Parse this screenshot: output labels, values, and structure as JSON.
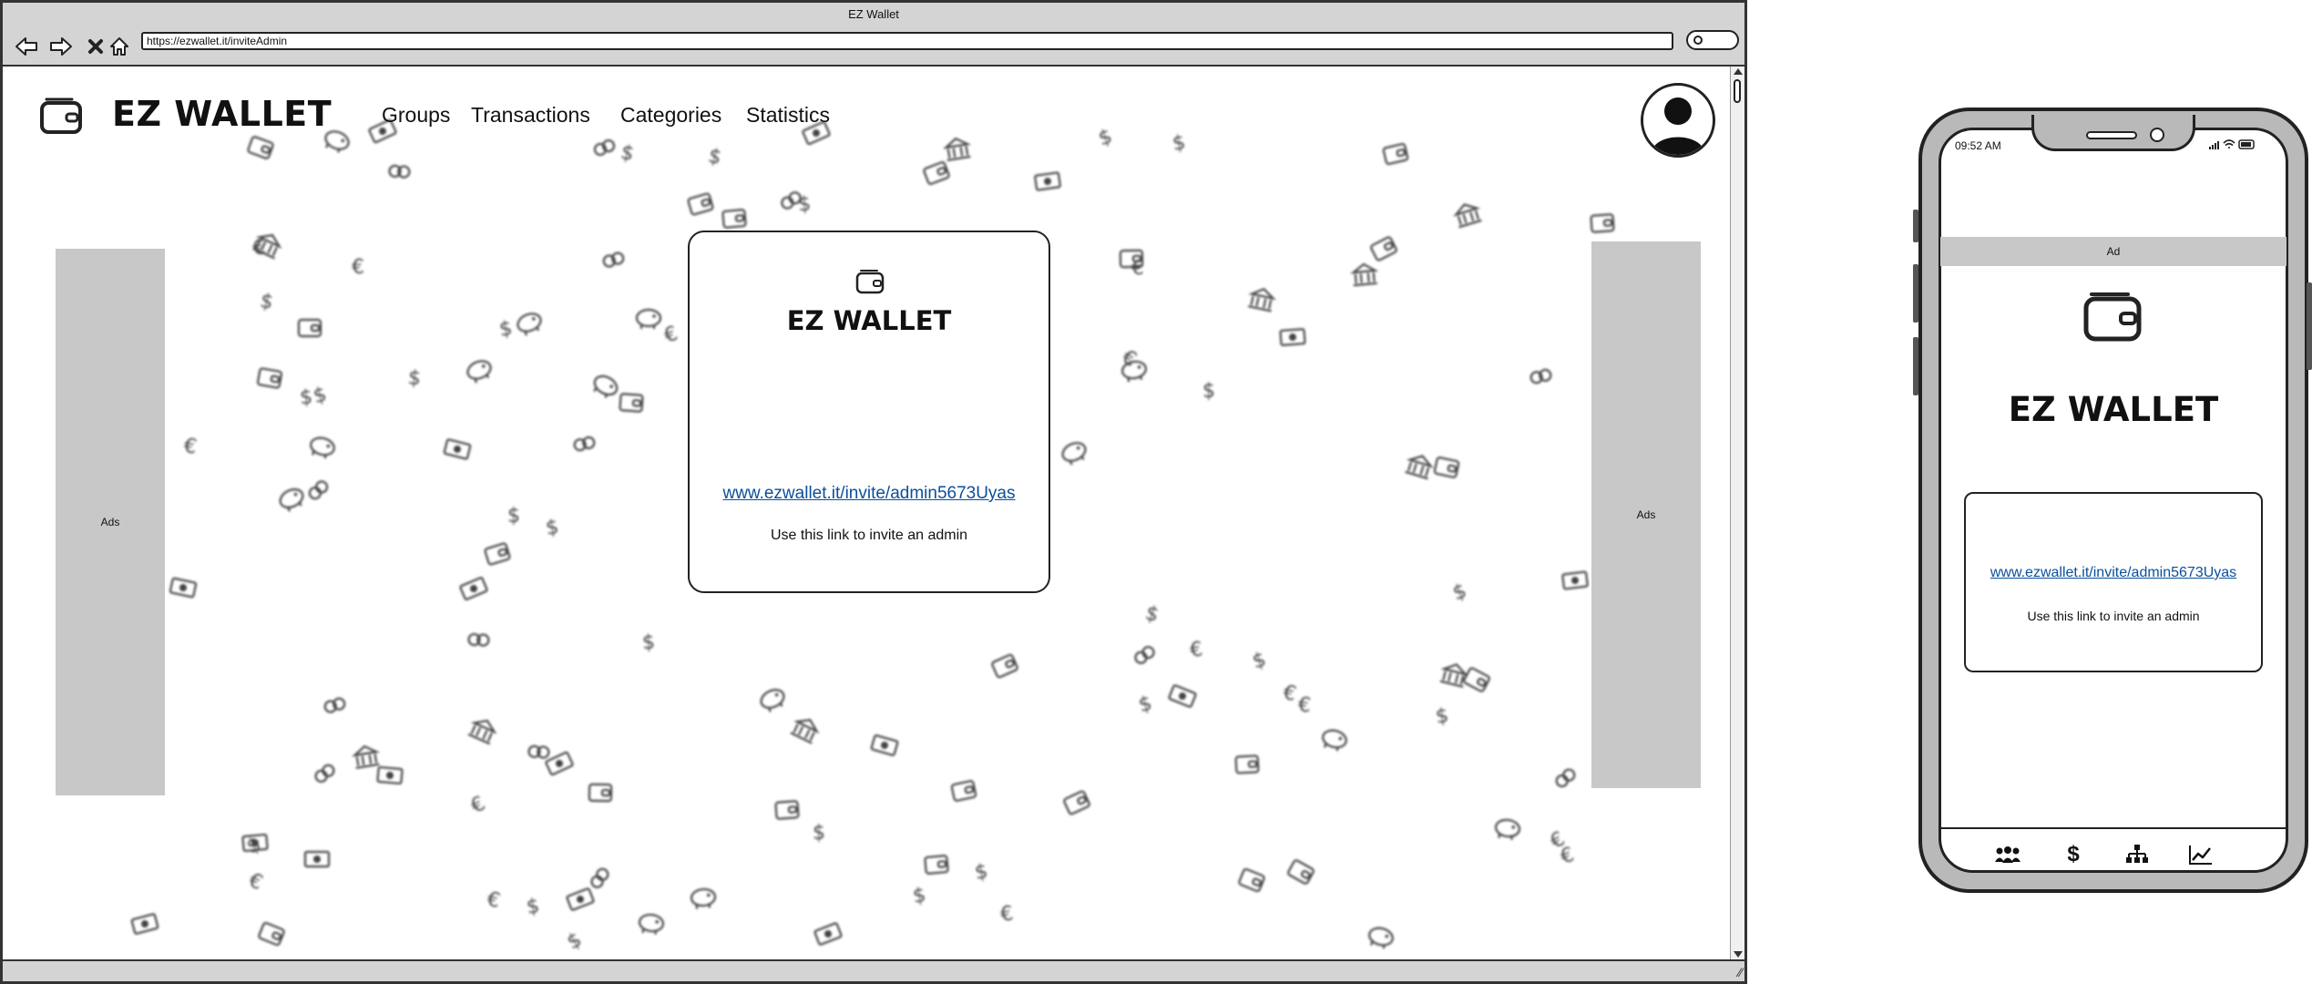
{
  "browser": {
    "window_title": "EZ Wallet",
    "url": "https://ezwallet.it/inviteAdmin"
  },
  "header": {
    "brand": "EZ WALLET",
    "nav": [
      "Groups",
      "Transactions",
      "Categories",
      "Statistics"
    ]
  },
  "ads": {
    "left_label": "Ads",
    "right_label": "Ads"
  },
  "invite_card": {
    "title": "EZ WALLET",
    "link": "www.ezwallet.it/invite/admin5673Uyas",
    "caption": "Use this link to invite an admin"
  },
  "mobile": {
    "status_time": "09:52 AM",
    "ad_label": "Ad",
    "title": "EZ WALLET",
    "link": "www.ezwallet.it/invite/admin5673Uyas",
    "caption": "Use this link to invite an admin",
    "tabs": [
      "groups-icon",
      "dollar-icon",
      "hierarchy-icon",
      "chart-icon"
    ]
  },
  "colors": {
    "link": "#0a4f9c",
    "ad_gray": "#c8c8c8",
    "chrome_gray": "#d4d4d4"
  }
}
